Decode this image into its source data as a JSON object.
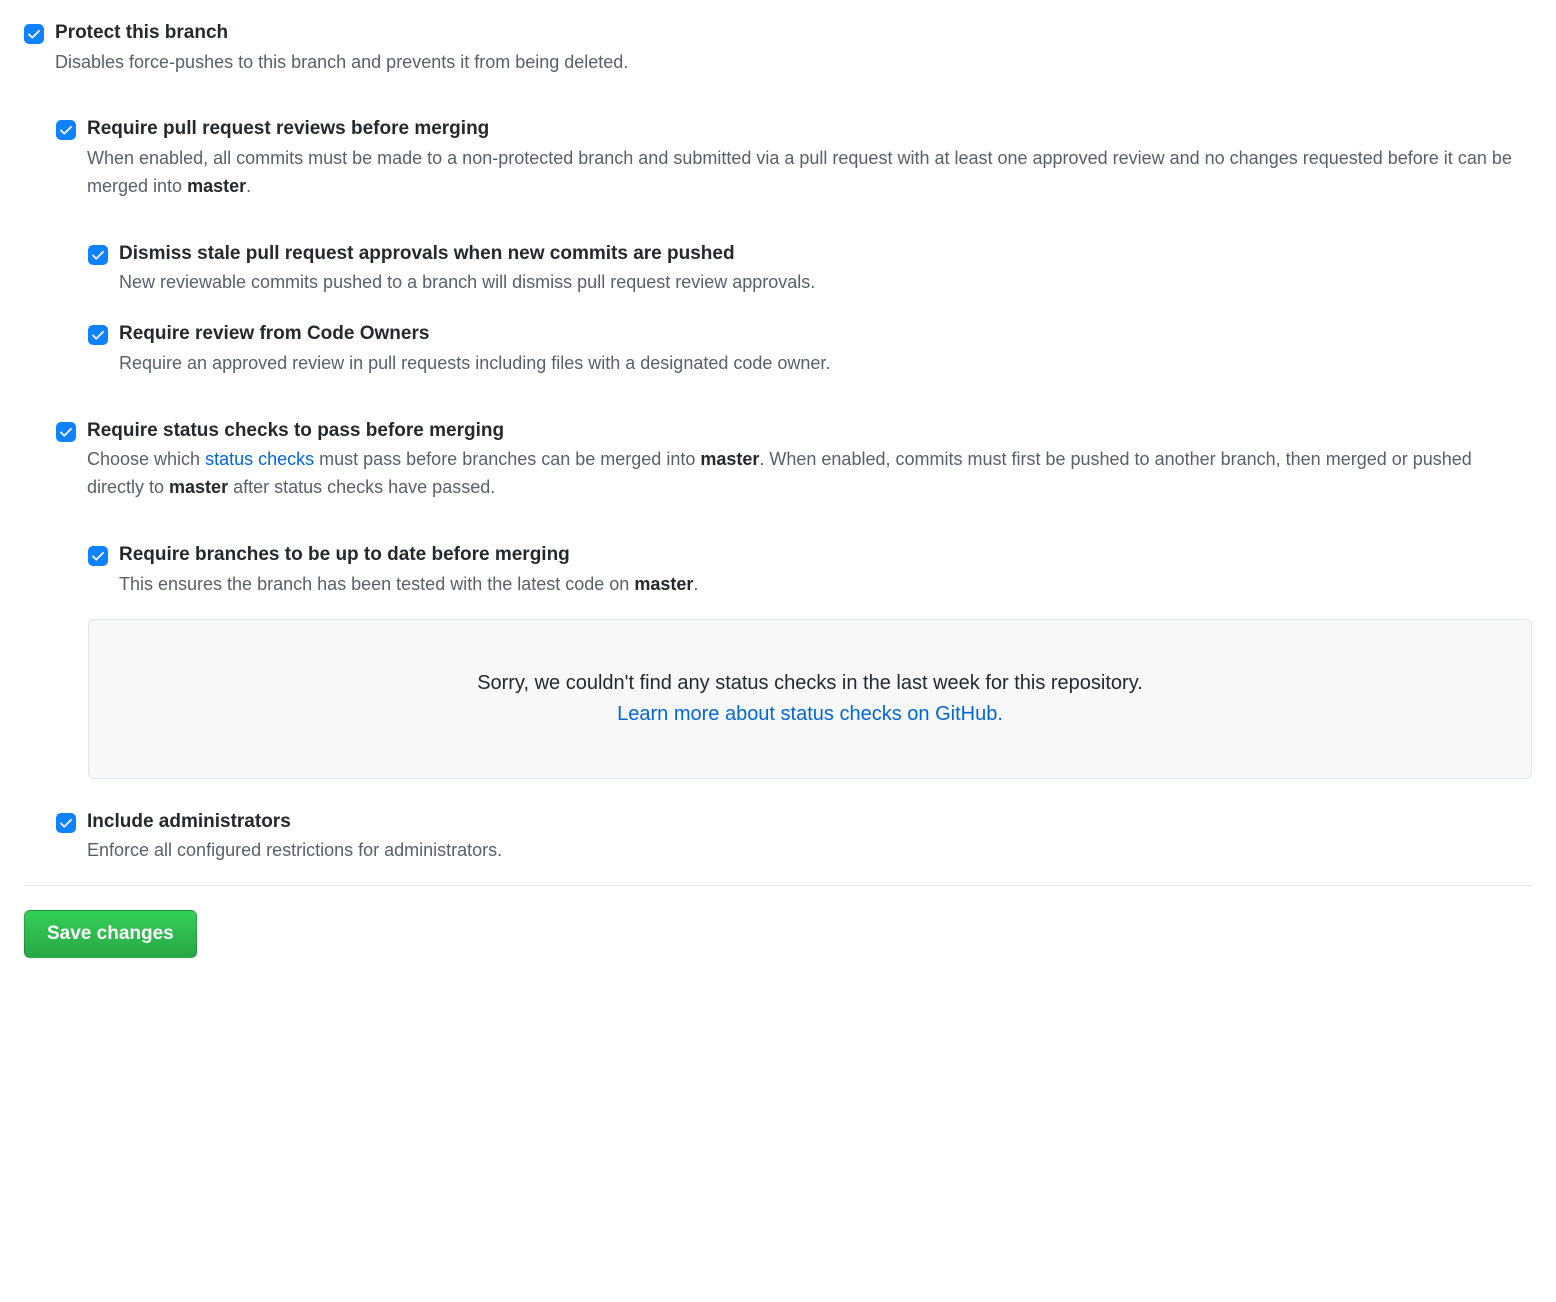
{
  "protect": {
    "title": "Protect this branch",
    "desc": "Disables force-pushes to this branch and prevents it from being deleted."
  },
  "require_reviews": {
    "title": "Require pull request reviews before merging",
    "desc_pre": "When enabled, all commits must be made to a non-protected branch and submitted via a pull request with at least one approved review and no changes requested before it can be merged into ",
    "desc_branch": "master",
    "desc_post": "."
  },
  "dismiss_stale": {
    "title": "Dismiss stale pull request approvals when new commits are pushed",
    "desc": "New reviewable commits pushed to a branch will dismiss pull request review approvals."
  },
  "code_owners": {
    "title": "Require review from Code Owners",
    "desc": "Require an approved review in pull requests including files with a designated code owner."
  },
  "status_checks": {
    "title": "Require status checks to pass before merging",
    "desc_pre": "Choose which ",
    "desc_link": "status checks",
    "desc_mid1": " must pass before branches can be merged into ",
    "desc_branch1": "master",
    "desc_mid2": ". When enabled, commits must first be pushed to another branch, then merged or pushed directly to ",
    "desc_branch2": "master",
    "desc_post": " after status checks have passed."
  },
  "up_to_date": {
    "title": "Require branches to be up to date before merging",
    "desc_pre": "This ensures the branch has been tested with the latest code on ",
    "desc_branch": "master",
    "desc_post": "."
  },
  "info": {
    "msg": "Sorry, we couldn't find any status checks in the last week for this repository.",
    "link": "Learn more about status checks on GitHub."
  },
  "include_admins": {
    "title": "Include administrators",
    "desc": "Enforce all configured restrictions for administrators."
  },
  "save_label": "Save changes"
}
